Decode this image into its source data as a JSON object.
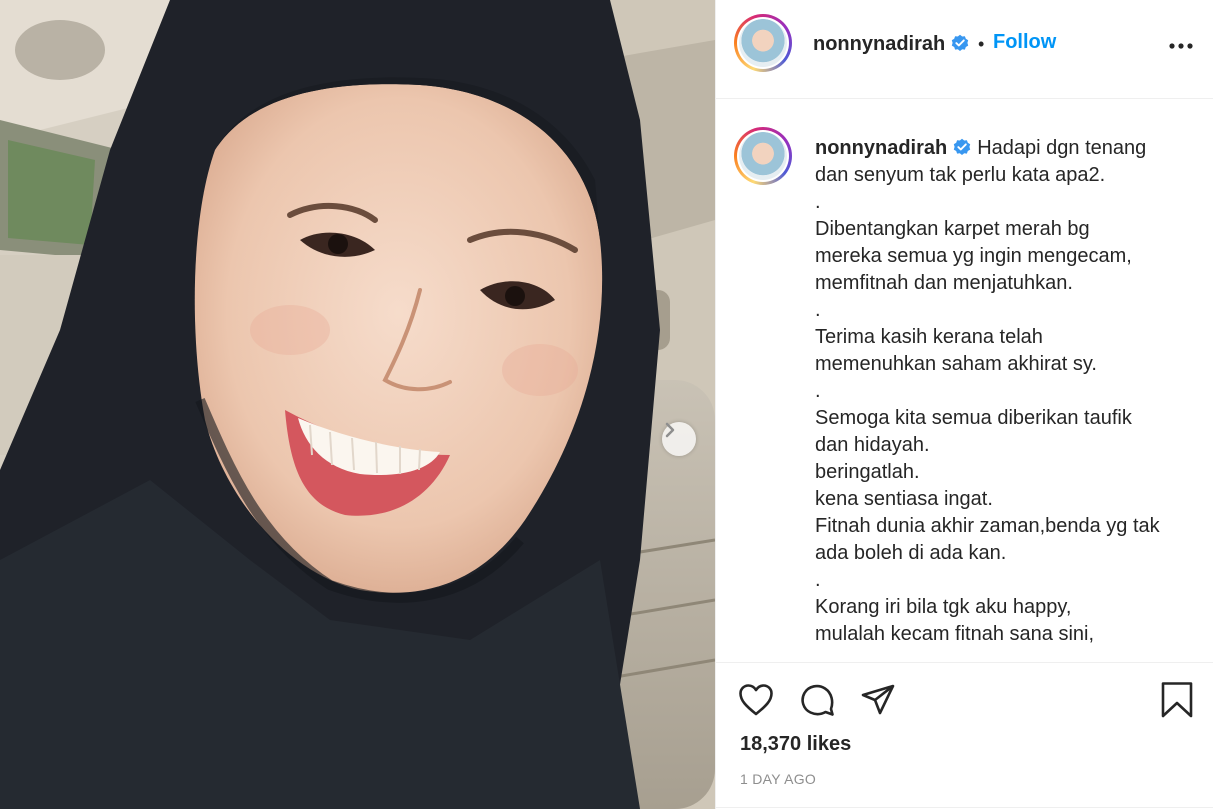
{
  "post": {
    "username": "nonnynadirah",
    "follow_label": "Follow",
    "separator": "•",
    "caption_lines": [
      "Hadapi dgn tenang",
      "dan senyum tak perlu kata apa2.",
      ".",
      "Dibentangkan karpet merah bg",
      "mereka semua yg ingin mengecam,",
      "memfitnah dan menjatuhkan.",
      ".",
      "Terima kasih kerana telah",
      "memenuhkan saham akhirat sy.",
      ".",
      "Semoga kita semua diberikan taufik",
      "dan hidayah.",
      "beringatlah.",
      "kena sentiasa ingat.",
      "Fitnah dunia akhir zaman,benda yg tak",
      "ada boleh di ada kan.",
      ".",
      "Korang iri bila tgk aku happy,",
      "mulalah kecam fitnah sana sini,"
    ],
    "likes": "18,370 likes",
    "timestamp": "1 DAY AGO"
  },
  "icons": {
    "verified": "verified-badge-icon",
    "more": "more-options-icon",
    "like": "heart-icon",
    "comment": "comment-bubble-icon",
    "share": "paper-plane-icon",
    "save": "bookmark-icon",
    "next": "chevron-right-icon"
  },
  "colors": {
    "accent": "#0095f6",
    "verified": "#3897f0",
    "text": "#262626",
    "muted": "#8e8e8e",
    "divider": "#efefef"
  }
}
